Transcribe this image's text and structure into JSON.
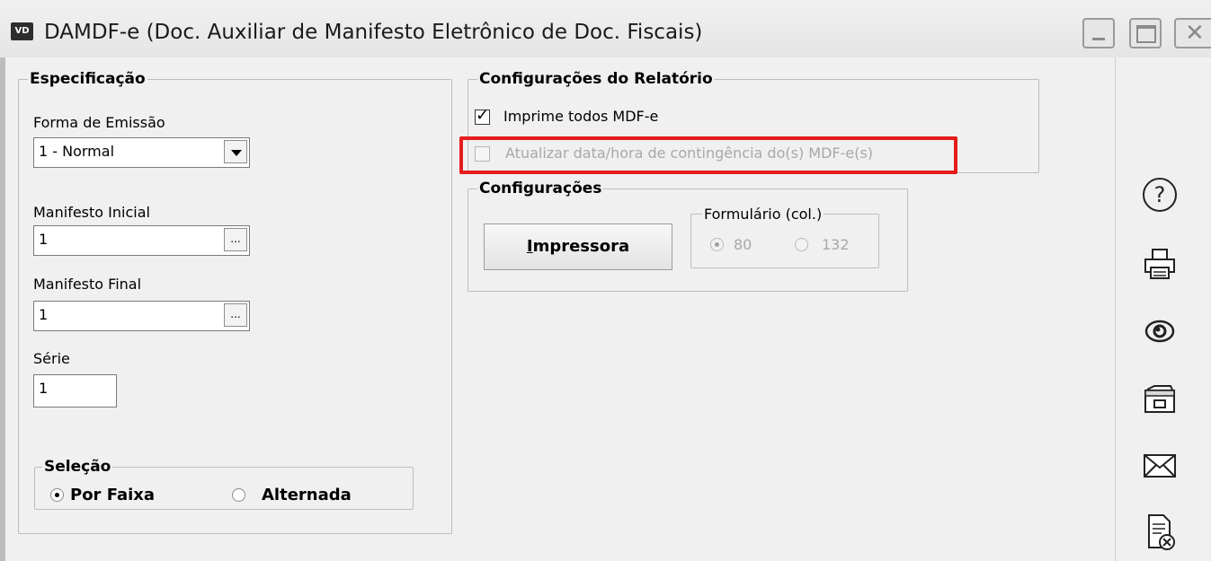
{
  "window": {
    "app_badge": "VD",
    "title": "DAMDF-e (Doc. Auxiliar de Manifesto Eletrônico de Doc. Fiscais)"
  },
  "especificacao": {
    "legend": "Especificação",
    "forma_emissao_label": "Forma de Emissão",
    "forma_emissao_value": "1 - Normal",
    "manifesto_inicial_label": "Manifesto Inicial",
    "manifesto_inicial_value": "1",
    "manifesto_final_label": "Manifesto Final",
    "manifesto_final_value": "1",
    "serie_label": "Série",
    "serie_value": "1",
    "lookup_label": "..."
  },
  "selecao": {
    "legend": "Seleção",
    "options": [
      {
        "label": "Por Faixa",
        "selected": true
      },
      {
        "label": "Alternada",
        "selected": false
      }
    ]
  },
  "config_relatorio": {
    "legend": "Configurações do Relatório",
    "imprime_todos_label": "Imprime todos MDF-e",
    "imprime_todos_checked": true,
    "atualizar_label": "Atualizar data/hora de contingência do(s) MDF-e(s)",
    "atualizar_checked": false,
    "atualizar_enabled": false
  },
  "configuracoes": {
    "legend": "Configurações",
    "impressora_first": "I",
    "impressora_rest": "mpressora",
    "formulario_legend": "Formulário (col.)",
    "formulario_options": [
      {
        "label": "80",
        "selected": true
      },
      {
        "label": "132",
        "selected": false
      }
    ]
  },
  "toolbar": {
    "icons": [
      "help-icon",
      "printer-icon",
      "preview-eye-icon",
      "folder-drawer-icon",
      "email-icon",
      "cancel-document-icon"
    ]
  },
  "highlight_color": "#e61c1c"
}
